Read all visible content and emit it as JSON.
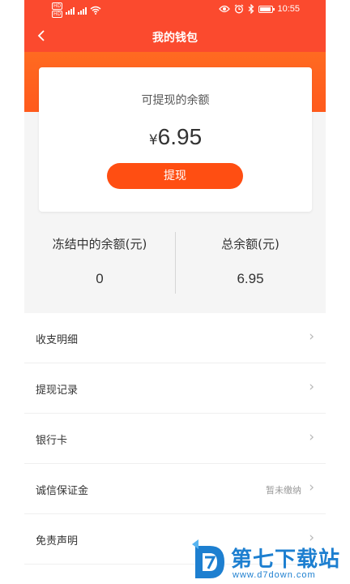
{
  "status_bar": {
    "time": "10:55",
    "hd_tags": [
      "HD",
      "HD"
    ],
    "icons": [
      "hd-icon",
      "signal-icon",
      "wifi-icon",
      "eye-icon",
      "alarm-icon",
      "bluetooth-icon",
      "battery-icon"
    ]
  },
  "nav": {
    "back_icon": "chevron-left-icon",
    "title": "我的钱包"
  },
  "balance_card": {
    "label": "可提现的余额",
    "currency": "¥",
    "amount": "6.95",
    "withdraw_button": "提现"
  },
  "stats": {
    "frozen_label": "冻结中的余额(元)",
    "frozen_value": "0",
    "total_label": "总余额(元)",
    "total_value": "6.95"
  },
  "menu": [
    {
      "label": "收支明细",
      "status": ""
    },
    {
      "label": "提现记录",
      "status": ""
    },
    {
      "label": "银行卡",
      "status": ""
    },
    {
      "label": "诚信保证金",
      "status": "暂未缴纳"
    },
    {
      "label": "免责声明",
      "status": ""
    }
  ],
  "watermark": {
    "name": "第七下载站",
    "url": "www.d7down.com"
  },
  "colors": {
    "header": "#fb4a2e",
    "accent_band": "#ff5a1c",
    "button": "#ff4e12",
    "background": "#f5f5f5",
    "watermark": "#1d7fd0"
  }
}
